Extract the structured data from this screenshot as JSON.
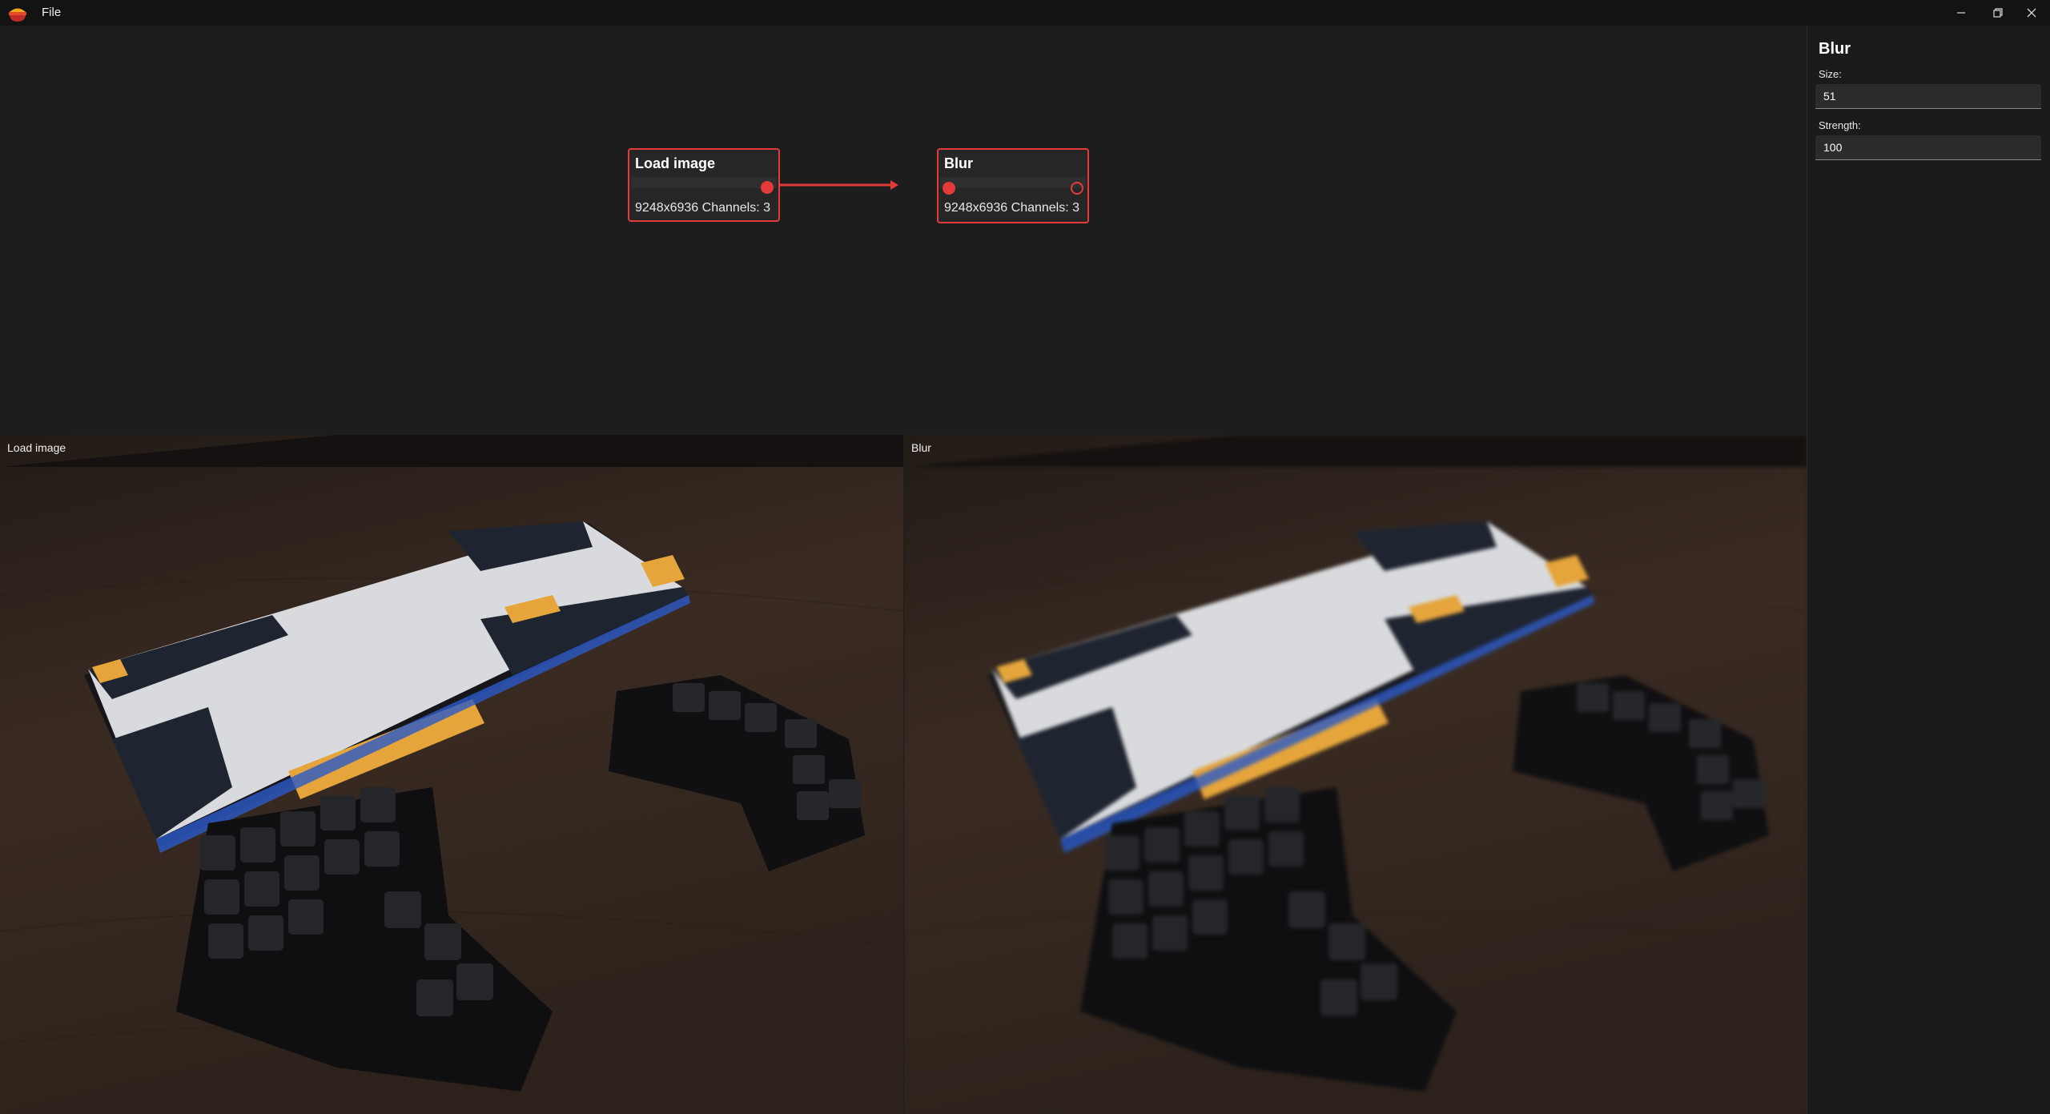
{
  "titlebar": {
    "menu_file": "File"
  },
  "graph": {
    "nodes": [
      {
        "title": "Load image",
        "info": "9248x6936 Channels: 3"
      },
      {
        "title": "Blur",
        "info": "9248x6936 Channels: 3"
      }
    ]
  },
  "previews": {
    "left_label": "Load image",
    "right_label": "Blur"
  },
  "properties": {
    "title": "Blur",
    "size_label": "Size:",
    "size_value": "51",
    "strength_label": "Strength:",
    "strength_value": "100"
  },
  "colors": {
    "accent": "#e53a3a",
    "titlebar": "#131313",
    "canvas": "#1d1d1d",
    "keycap_orange": "#e5a53a"
  }
}
